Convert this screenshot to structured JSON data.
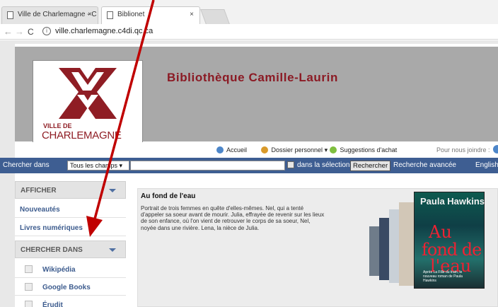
{
  "browser": {
    "tabs": [
      {
        "label": "Ville de Charlemagne - C"
      },
      {
        "label": "Biblionet"
      }
    ],
    "tab_close": "×",
    "address": "ville.charlemagne.c4di.qc.ca"
  },
  "site": {
    "logo": {
      "ville": "VILLE DE",
      "name": "CHARLEMAGNE"
    },
    "title": "Bibliothèque Camille-Laurin"
  },
  "toplinks": [
    {
      "label": "Accueil"
    },
    {
      "label": "Dossier personnel",
      "dropdown": true
    },
    {
      "label": "Suggestions d'achat"
    },
    {
      "label": "Pour nous joindre :"
    }
  ],
  "searchbar": {
    "label": "Chercher dans",
    "select_value": "Tous les champs",
    "query": "",
    "in_selection": "dans la sélection",
    "search_button": "Rechercher",
    "advanced": "Recherche avancée",
    "language": "English"
  },
  "sidebar": {
    "afficher": {
      "heading": "AFFICHER",
      "items": [
        {
          "label": "Nouveautés"
        },
        {
          "label": "Livres numériques"
        }
      ]
    },
    "chercher": {
      "heading": "CHERCHER DANS",
      "items": [
        {
          "label": "Wikipédia"
        },
        {
          "label": "Google Books"
        },
        {
          "label": "Érudit"
        }
      ]
    }
  },
  "featured": {
    "title": "Au fond de l'eau",
    "description": "Portrait de trois femmes en quête d'elles-mêmes. Nel, qui a tenté d'appeler sa soeur avant de mourir. Julia, effrayée de revenir sur les lieux de son enfance, où l'on vient de retrouver le corps de sa soeur, Nel, noyée dans une rivière. Lena, la nièce de Julia.",
    "cover": {
      "author": "Paula Hawkins",
      "title_lines": [
        "Au",
        "fond de",
        "l'eau"
      ],
      "tagline": "Après La Fille du train, le nouveau roman de Paula Hawkins"
    }
  },
  "colors": {
    "brand": "#8b1a24",
    "searchbar": "#3e5e92",
    "sidebar_link": "#3d5c8e",
    "annotation_arrow": "#c00000"
  }
}
